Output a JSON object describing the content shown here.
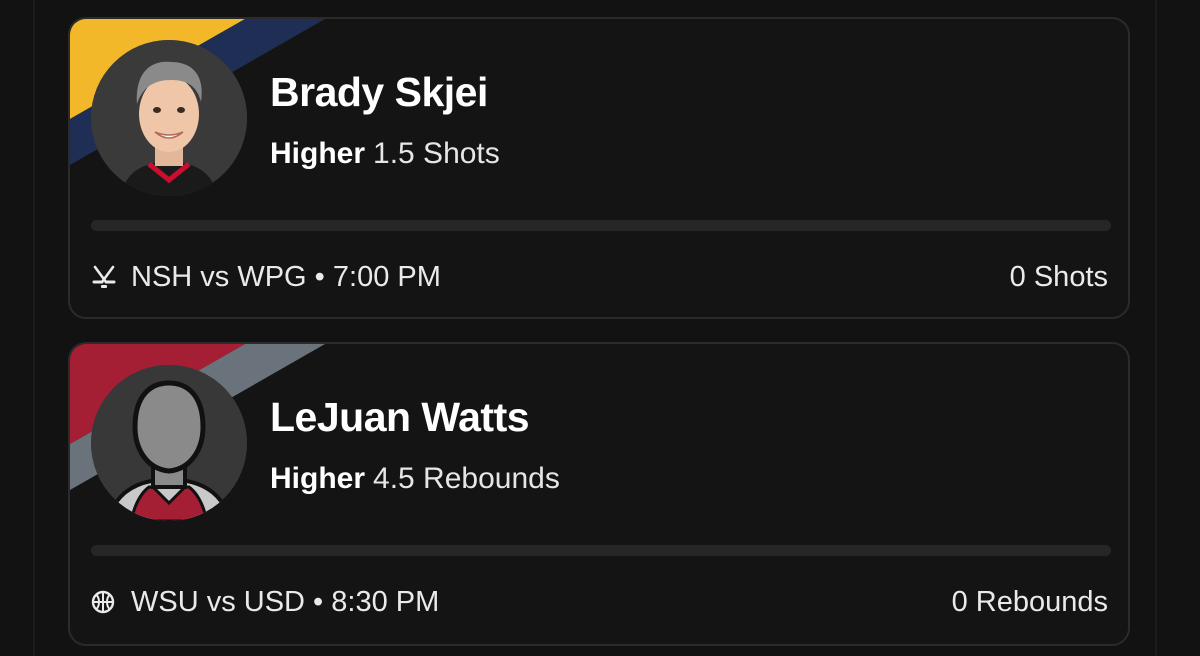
{
  "colors": {
    "background": "#121212",
    "card_background": "#141414",
    "card_border": "#2b2b2b",
    "nsh_gold": "#f2b82a",
    "nsh_navy": "#1e2e55",
    "wsu_crimson": "#a41f34",
    "wsu_gray": "#6a737b"
  },
  "picks": [
    {
      "player": "Brady Skjei",
      "direction": "Higher",
      "line": "1.5 Shots",
      "progress": 0,
      "sport_icon": "hockey-sticks-icon",
      "game": "NSH vs WPG • 7:00 PM",
      "result": "0 Shots"
    },
    {
      "player": "LeJuan Watts",
      "direction": "Higher",
      "line": "4.5 Rebounds",
      "progress": 0,
      "sport_icon": "basketball-icon",
      "game": "WSU vs USD • 8:30 PM",
      "result": "0 Rebounds"
    }
  ]
}
